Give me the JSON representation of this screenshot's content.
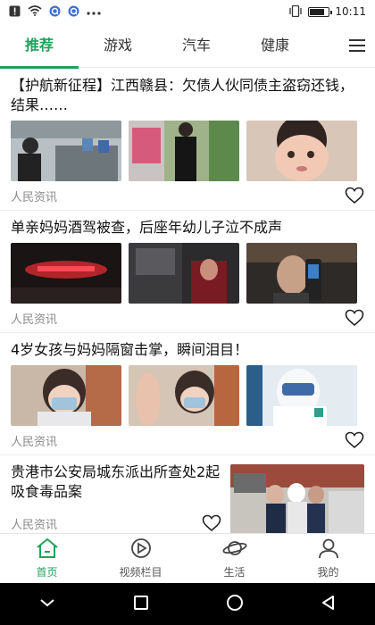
{
  "status_bar": {
    "left_icons": [
      "alert-icon",
      "wifi-icon",
      "q-app-icon",
      "q-app-icon-2",
      "more-dots-icon"
    ],
    "right_icons": [
      "vibrate-icon",
      "battery-icon"
    ],
    "battery_level": 0.8,
    "time": "10:11"
  },
  "tabs": [
    {
      "label": "推荐",
      "active": true
    },
    {
      "label": "游戏",
      "active": false
    },
    {
      "label": "汽车",
      "active": false
    },
    {
      "label": "健康",
      "active": false
    }
  ],
  "accent_color": "#21a15b",
  "articles": [
    {
      "title": "【护航新征程】江西赣县：欠债人伙同债主盗窃还钱，结果……",
      "source": "人民资讯"
    },
    {
      "title": "单亲妈妈酒驾被查，后座年幼儿子泣不成声",
      "source": "人民资讯"
    },
    {
      "title": "4岁女孩与妈妈隔窗击掌，瞬间泪目！",
      "source": "人民资讯"
    },
    {
      "title": "贵港市公安局城东派出所查处2起吸食毒品案",
      "source": "人民资讯"
    }
  ],
  "bottom_nav": [
    {
      "label": "首页",
      "icon": "home-icon",
      "active": true
    },
    {
      "label": "视频栏目",
      "icon": "video-play-icon",
      "active": false
    },
    {
      "label": "生活",
      "icon": "planet-icon",
      "active": false
    },
    {
      "label": "我的",
      "icon": "user-icon",
      "active": false
    }
  ],
  "system_nav": [
    "chevron-down-icon",
    "recent-apps-icon",
    "home-circle-icon",
    "back-triangle-icon"
  ]
}
